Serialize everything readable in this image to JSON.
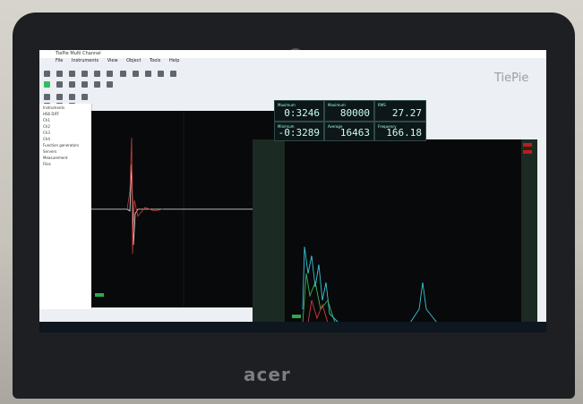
{
  "app": {
    "title": "TiePie Multi Channel",
    "menu": [
      "File",
      "Instruments",
      "View",
      "Object",
      "Tools",
      "Help"
    ],
    "logo": "TiePie"
  },
  "tree": {
    "items": [
      "Instruments",
      "HS6 DIFF",
      "Ch1",
      "Ch2",
      "Ch3",
      "Ch4",
      "Function generators",
      "Servers",
      "Measurement",
      "Files"
    ]
  },
  "meters": [
    {
      "label": "Maximum",
      "value": "0:3246"
    },
    {
      "label": "Maximum",
      "value": "80000"
    },
    {
      "label": "RMS",
      "value": "27.27"
    },
    {
      "label": "Minimum",
      "value": "-0:3289"
    },
    {
      "label": "Average",
      "value": "16463"
    },
    {
      "label": "Frequency",
      "value": "166.18"
    }
  ],
  "brand": "acer",
  "colors": {
    "trace_cyan": "#37c6d8",
    "trace_red": "#d23a3a",
    "trace_green": "#3fb35a",
    "trace_white": "#e6e6e6",
    "bg_scope": "#08090a"
  }
}
